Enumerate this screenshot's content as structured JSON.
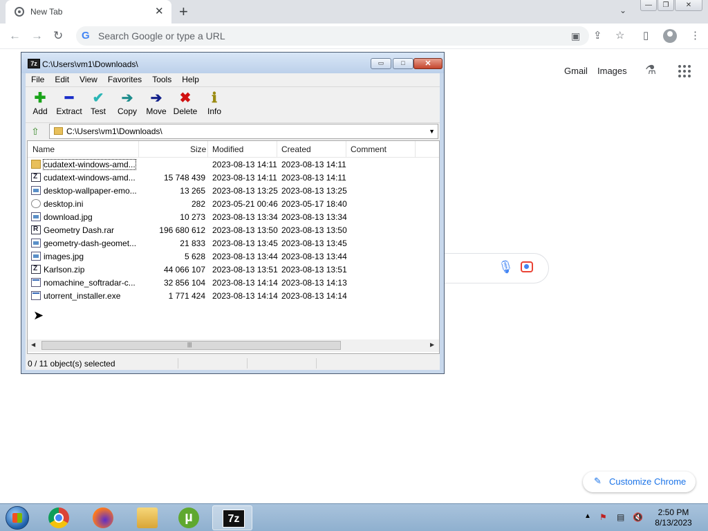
{
  "browser": {
    "tab_title": "New Tab",
    "tab_close": "✕",
    "new_tab": "+",
    "tab_search": "⌄",
    "omnibox_placeholder": "Search Google or type a URL",
    "google_g": "G",
    "window_controls": {
      "minimize": "—",
      "restore": "❐",
      "close": "✕"
    },
    "nav": {
      "back": "←",
      "forward": "→",
      "reload": "↻"
    },
    "toolbar_icons": {
      "blocked": "▣",
      "share": "⇪",
      "star": "☆",
      "sidepanel": "▯",
      "menu": "⋮"
    }
  },
  "ntp": {
    "gmail": "Gmail",
    "images": "Images",
    "labs_icon": "⚗",
    "mic_icon": "🎙",
    "customize_label": "Customize Chrome",
    "customize_icon": "✎"
  },
  "sevenzip": {
    "app_icon": "7z",
    "title": "C:\\Users\\vm1\\Downloads\\",
    "title_buttons": {
      "minimize": "▭",
      "maximize": "□",
      "close": "✕"
    },
    "menu": [
      "File",
      "Edit",
      "View",
      "Favorites",
      "Tools",
      "Help"
    ],
    "tools": [
      {
        "label": "Add",
        "icon": "✚",
        "color": "#19a319"
      },
      {
        "label": "Extract",
        "icon": "━",
        "color": "#1a2ec8"
      },
      {
        "label": "Test",
        "icon": "✔",
        "color": "#2bb5b5"
      },
      {
        "label": "Copy",
        "icon": "➔",
        "color": "#1d8c8c"
      },
      {
        "label": "Move",
        "icon": "➔",
        "color": "#12208a"
      },
      {
        "label": "Delete",
        "icon": "✖",
        "color": "#d01010"
      },
      {
        "label": "Info",
        "icon": "ℹ",
        "color": "#9a8a10"
      }
    ],
    "up_icon": "⇧",
    "address": "C:\\Users\\vm1\\Downloads\\",
    "address_dropdown": "▼",
    "columns": {
      "name": "Name",
      "size": "Size",
      "modified": "Modified",
      "created": "Created",
      "comment": "Comment"
    },
    "files": [
      {
        "name": "cudatext-windows-amd...",
        "size": "",
        "modified": "2023-08-13 14:11",
        "created": "2023-08-13 14:11",
        "type": "folder"
      },
      {
        "name": "cudatext-windows-amd...",
        "size": "15 748 439",
        "modified": "2023-08-13 14:11",
        "created": "2023-08-13 14:11",
        "type": "arc"
      },
      {
        "name": "desktop-wallpaper-emo...",
        "size": "13 265",
        "modified": "2023-08-13 13:25",
        "created": "2023-08-13 13:25",
        "type": "img"
      },
      {
        "name": "desktop.ini",
        "size": "282",
        "modified": "2023-05-21 00:46",
        "created": "2023-05-17 18:40",
        "type": "ini"
      },
      {
        "name": "download.jpg",
        "size": "10 273",
        "modified": "2023-08-13 13:34",
        "created": "2023-08-13 13:34",
        "type": "img"
      },
      {
        "name": "Geometry Dash.rar",
        "size": "196 680 612",
        "modified": "2023-08-13 13:50",
        "created": "2023-08-13 13:50",
        "type": "arc rar"
      },
      {
        "name": "geometry-dash-geomet...",
        "size": "21 833",
        "modified": "2023-08-13 13:45",
        "created": "2023-08-13 13:45",
        "type": "img"
      },
      {
        "name": "images.jpg",
        "size": "5 628",
        "modified": "2023-08-13 13:44",
        "created": "2023-08-13 13:44",
        "type": "img"
      },
      {
        "name": "Karlson.zip",
        "size": "44 066 107",
        "modified": "2023-08-13 13:51",
        "created": "2023-08-13 13:51",
        "type": "arc"
      },
      {
        "name": "nomachine_softradar-c...",
        "size": "32 856 104",
        "modified": "2023-08-13 14:14",
        "created": "2023-08-13 14:13",
        "type": "exe"
      },
      {
        "name": "utorrent_installer.exe",
        "size": "1 771 424",
        "modified": "2023-08-13 14:14",
        "created": "2023-08-13 14:14",
        "type": "exe"
      }
    ],
    "scroll": {
      "left": "◀",
      "right": "▶",
      "grip": "|||"
    },
    "status": "0 / 11 object(s) selected"
  },
  "taskbar": {
    "apps": [
      "Google Chrome",
      "Firefox",
      "Windows Explorer",
      "uTorrent",
      "7-Zip"
    ],
    "utorrent_glyph": "µ",
    "sevenzip_glyph": "7z",
    "tray_arrow": "▲",
    "tray_icons": [
      "⚑",
      "▤",
      "🔇"
    ],
    "time": "2:50 PM",
    "date": "8/13/2023"
  }
}
